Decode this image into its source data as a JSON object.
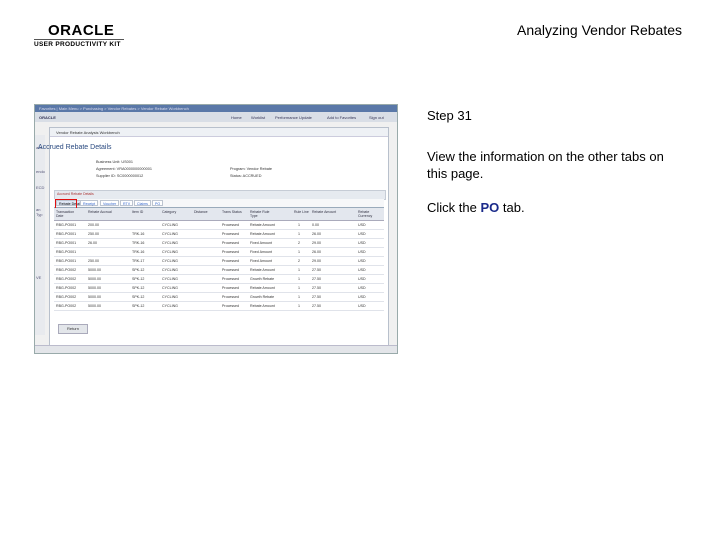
{
  "header": {
    "logo_word": "ORACLE",
    "logo_sub": "USER PRODUCTIVITY KIT",
    "title": "Analyzing Vendor Rebates"
  },
  "instructions": {
    "step": "Step 31",
    "description": "View the information on the other tabs on this page.",
    "click_prefix": "Click the ",
    "click_target": "PO",
    "click_suffix": " tab."
  },
  "screenshot": {
    "brand": "ORACLE",
    "window_title": "Vendor Rebate Analysis Workbench",
    "page_heading": "Accrued Rebate Details",
    "nav_links": [
      "Home",
      "Worklist",
      "Performance Update",
      "Add to Favorites",
      "Sign out"
    ],
    "header_fields": [
      "Business Unit: US001",
      "Agreement: VRA0000000000001",
      "Supplier ID: SC0000000012",
      "Program: Vendor Rebate",
      "Status: ACCRUED",
      "Currency: USD"
    ],
    "grid_label": "Accrued Rebate Details",
    "tabs": [
      "Rebate Details",
      "Receipt",
      "Voucher",
      "RTV",
      "Claims",
      "PO"
    ],
    "active_tab": "Rebate Details",
    "columns": [
      "Transaction Date",
      "Rebate Accrual",
      "Item ID",
      "Category",
      "Distance",
      "Trans Status",
      "Rebate Rule Type",
      "Rule Line",
      "Rebate Amount",
      "Rebate Currency"
    ],
    "rows": [
      [
        "RBG-PO001",
        "200.00",
        "",
        "CYCLING",
        "",
        "Processed",
        "Rebate Amount",
        "1",
        "0.00",
        "USD"
      ],
      [
        "RBG-PO001",
        "250.00",
        "TRK-16",
        "CYCLING",
        "",
        "Processed",
        "Rebate Amount",
        "1",
        "26.00",
        "USD"
      ],
      [
        "RBG-PO001",
        "26.00",
        "TRK-16",
        "CYCLING",
        "",
        "Processed",
        "Fixed Amount",
        "2",
        "29.00",
        "USD"
      ],
      [
        "RBG-PO001",
        "",
        "TRK-16",
        "CYCLING",
        "",
        "Processed",
        "Fixed Amount",
        "1",
        "26.00",
        "USD"
      ],
      [
        "RBG-PO001",
        "250.00",
        "TRK-17",
        "CYCLING",
        "",
        "Processed",
        "Fixed Amount",
        "2",
        "29.00",
        "USD"
      ],
      [
        "RBG-PO002",
        "5000.00",
        "SPK-12",
        "CYCLING",
        "",
        "Processed",
        "Rebate Amount",
        "1",
        "27.50",
        "USD"
      ],
      [
        "RBG-PO002",
        "5000.00",
        "SPK-12",
        "CYCLING",
        "",
        "Processed",
        "Growth Rebate",
        "1",
        "27.50",
        "USD"
      ],
      [
        "RBG-PO002",
        "5000.00",
        "SPK-12",
        "CYCLING",
        "",
        "Processed",
        "Rebate Amount",
        "1",
        "27.50",
        "USD"
      ],
      [
        "RBG-PO002",
        "5000.00",
        "SPK-12",
        "CYCLING",
        "",
        "Processed",
        "Growth Rebate",
        "1",
        "27.50",
        "USD"
      ],
      [
        "RBG-PO002",
        "5000.00",
        "SPK-12",
        "CYCLING",
        "",
        "Processed",
        "Rebate Amount",
        "1",
        "27.50",
        "USD"
      ]
    ],
    "return_button": "Return"
  }
}
